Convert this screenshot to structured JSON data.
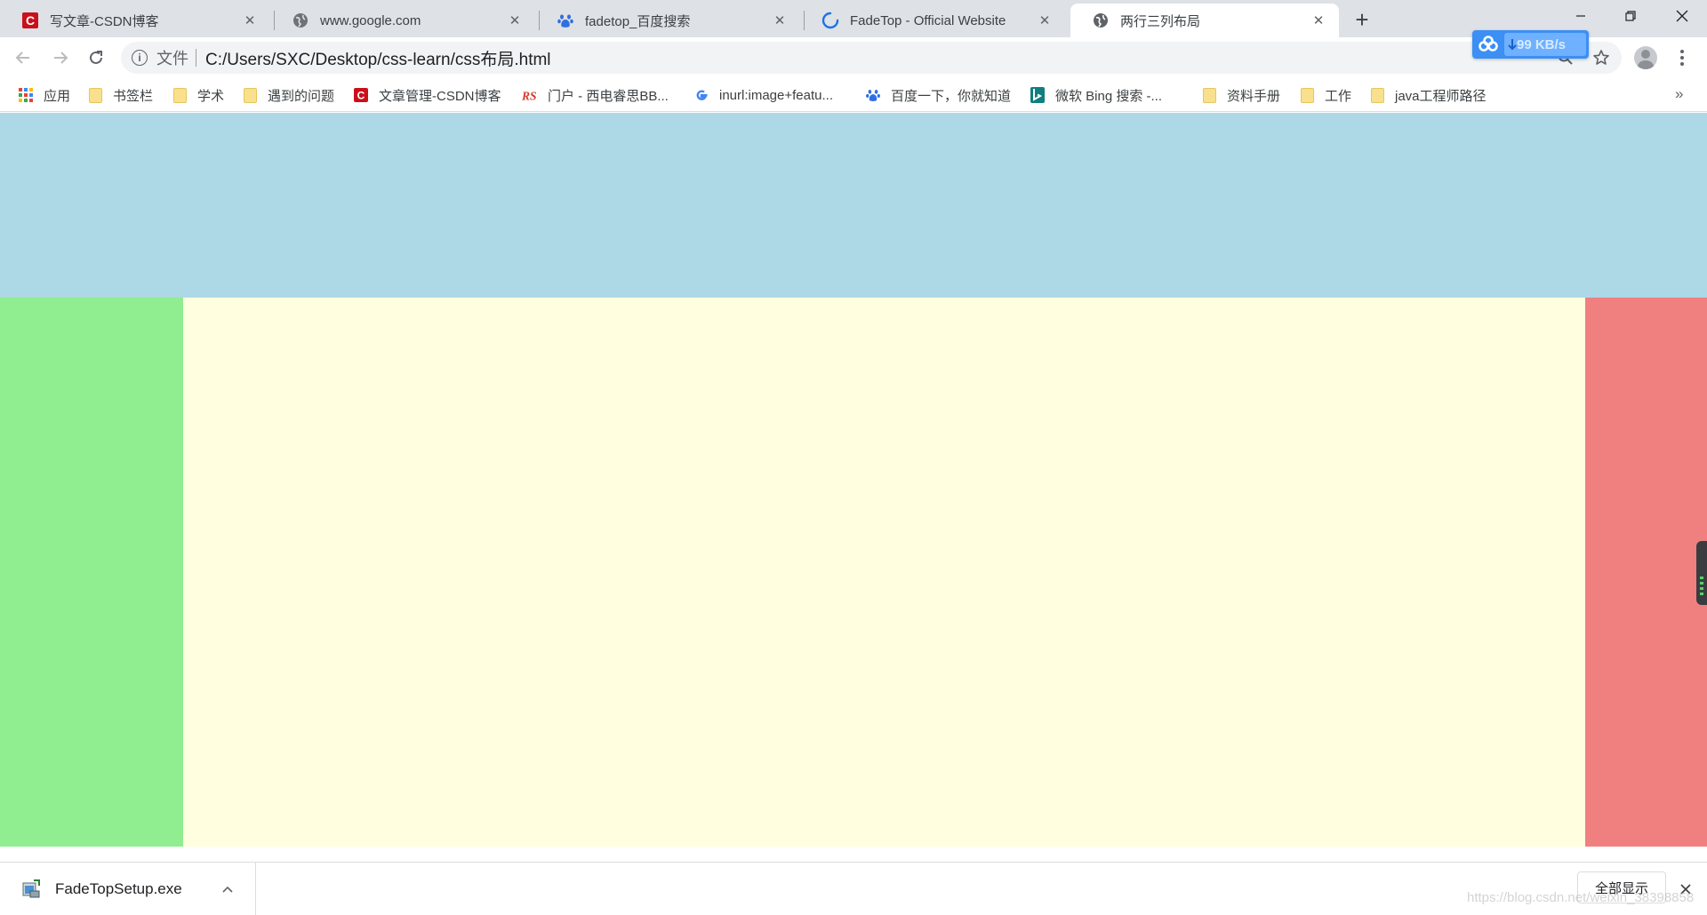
{
  "tabs": [
    {
      "title": "写文章-CSDN博客",
      "icon": "csdn-icon",
      "active": false
    },
    {
      "title": "www.google.com",
      "icon": "globe-icon",
      "active": false
    },
    {
      "title": "fadetop_百度搜索",
      "icon": "baidu-paw-icon",
      "active": false
    },
    {
      "title": "FadeTop - Official Website",
      "icon": "loading-spinner-icon",
      "active": false
    },
    {
      "title": "两行三列布局",
      "icon": "globe-icon",
      "active": true
    }
  ],
  "omnibox": {
    "scheme_label": "文件",
    "url": "C:/Users/SXC/Desktop/css-learn/css布局.html"
  },
  "speed_widget": {
    "rate": "99 KB/s"
  },
  "bookmarks": [
    {
      "label": "应用",
      "icon": "apps-grid-icon"
    },
    {
      "label": "书签栏",
      "icon": "folder-icon"
    },
    {
      "label": "学术",
      "icon": "folder-icon"
    },
    {
      "label": "遇到的问题",
      "icon": "folder-icon"
    },
    {
      "label": "文章管理-CSDN博客",
      "icon": "csdn-icon"
    },
    {
      "label": "门户 - 西电睿思BB...",
      "icon": "rs-icon"
    },
    {
      "label": "inurl:image+featu...",
      "icon": "google-g-icon"
    },
    {
      "label": "百度一下，你就知道",
      "icon": "baidu-paw-icon"
    },
    {
      "label": "微软 Bing 搜索 -...",
      "icon": "bing-icon"
    },
    {
      "label": "资料手册",
      "icon": "folder-icon"
    },
    {
      "label": "工作",
      "icon": "folder-icon"
    },
    {
      "label": "java工程师路径",
      "icon": "folder-icon"
    }
  ],
  "bookmarks_more": "»",
  "page_colors": {
    "header": "#add8e6",
    "left": "#90ee90",
    "center": "#ffffe0",
    "right": "#f08080"
  },
  "download_shelf": {
    "file_name": "FadeTopSetup.exe",
    "show_all_label": "全部显示"
  },
  "watermark": "https://blog.csdn.net/weixin_38398858"
}
